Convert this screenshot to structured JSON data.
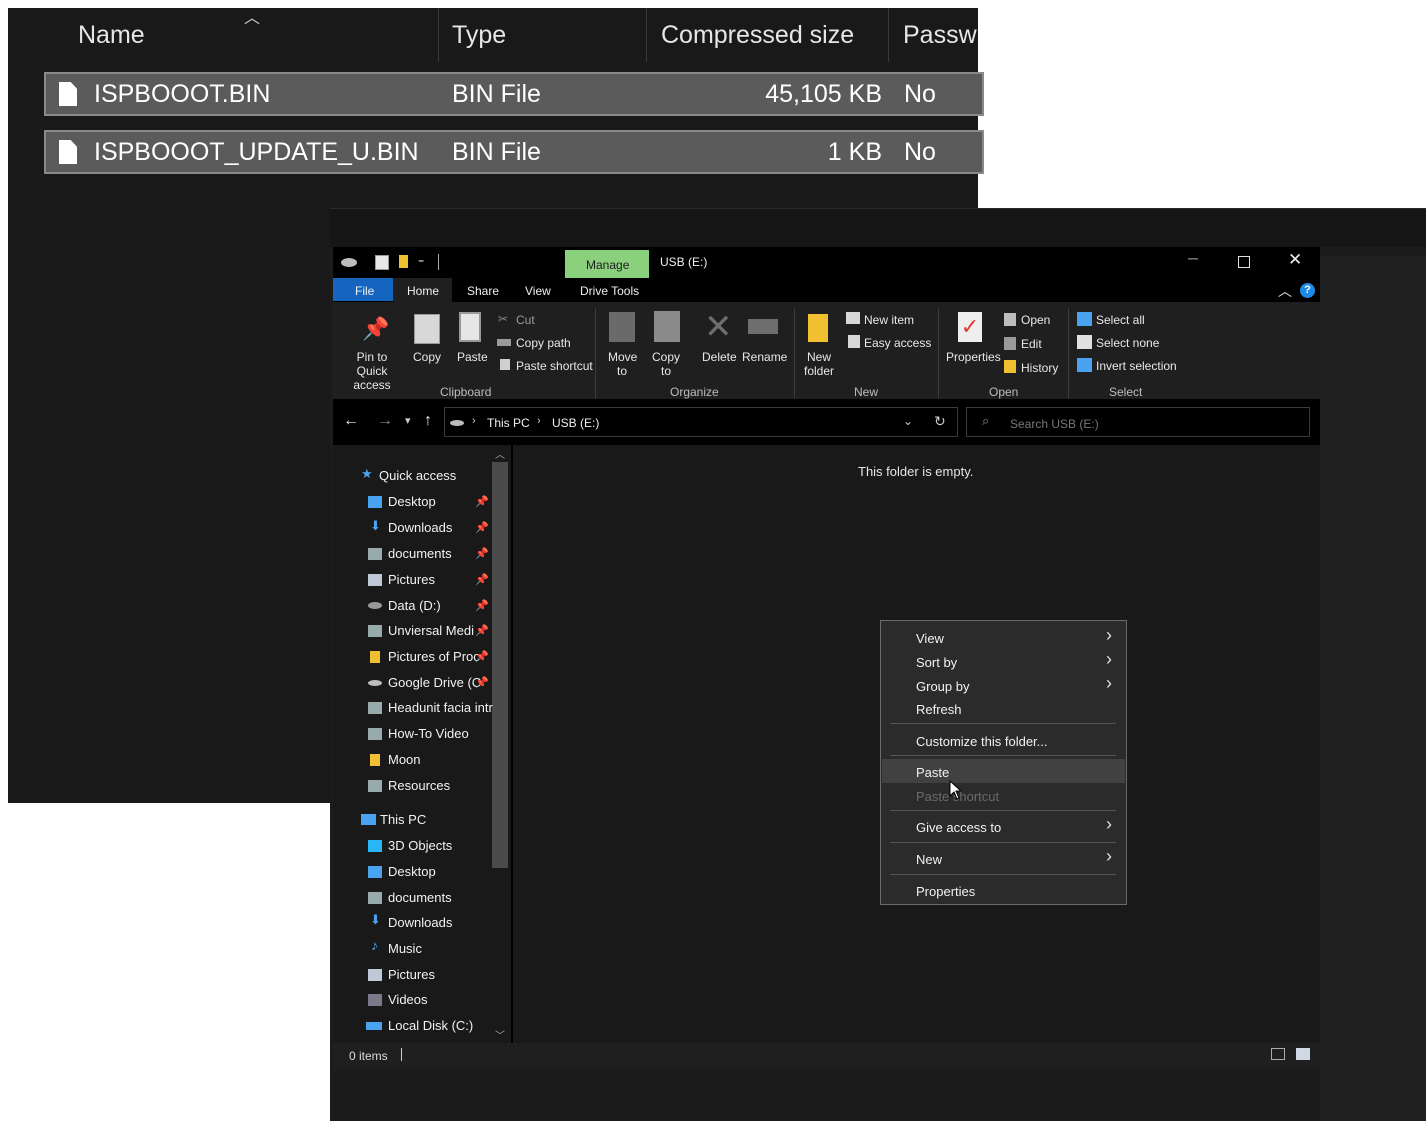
{
  "zip": {
    "headers": {
      "name": "Name",
      "type": "Type",
      "size": "Compressed size",
      "password": "Passw"
    },
    "files": [
      {
        "name": "ISPBOOOT.BIN",
        "type": "BIN File",
        "size": "45,105 KB",
        "password": "No"
      },
      {
        "name": "ISPBOOOT_UPDATE_U.BIN",
        "type": "BIN File",
        "size": "1 KB",
        "password": "No"
      }
    ]
  },
  "explorer": {
    "manage_tab": "Manage",
    "title": "USB (E:)",
    "tabs": {
      "file": "File",
      "home": "Home",
      "share": "Share",
      "view": "View",
      "drive_tools": "Drive Tools"
    },
    "ribbon": {
      "pin_quick_access": "Pin to Quick access",
      "copy": "Copy",
      "paste": "Paste",
      "cut": "Cut",
      "copy_path": "Copy path",
      "paste_shortcut": "Paste shortcut",
      "clipboard": "Clipboard",
      "move_to": "Move to",
      "copy_to": "Copy to",
      "delete": "Delete",
      "rename": "Rename",
      "organize": "Organize",
      "new_folder": "New folder",
      "new_item": "New item",
      "easy_access": "Easy access",
      "new": "New",
      "properties": "Properties",
      "open_btn": "Open",
      "edit": "Edit",
      "history": "History",
      "open": "Open",
      "select_all": "Select all",
      "select_none": "Select none",
      "invert_selection": "Invert selection",
      "select": "Select"
    },
    "address": {
      "this_pc": "This PC",
      "drive": "USB (E:)",
      "search_placeholder": "Search USB (E:)"
    },
    "empty_message": "This folder is empty.",
    "nav": {
      "quick_access": "Quick access",
      "quick_items": [
        "Desktop",
        "Downloads",
        "documents",
        "Pictures",
        "Data (D:)",
        "Unviersal Medi",
        "Pictures of Proc",
        "Google Drive (C",
        "Headunit facia intr",
        "How-To Video",
        "Moon",
        "Resources"
      ],
      "this_pc": "This PC",
      "pc_items": [
        "3D Objects",
        "Desktop",
        "documents",
        "Downloads",
        "Music",
        "Pictures",
        "Videos",
        "Local Disk (C:)"
      ]
    },
    "context_menu": {
      "view": "View",
      "sort_by": "Sort by",
      "group_by": "Group by",
      "refresh": "Refresh",
      "customize": "Customize this folder...",
      "paste": "Paste",
      "paste_shortcut": "Paste shortcut",
      "give_access": "Give access to",
      "new": "New",
      "properties": "Properties"
    },
    "status": "0 items",
    "colors": {
      "accent": "#0a64c8",
      "manage_tab": "#8bd07c",
      "folder": "#f0c030"
    }
  }
}
